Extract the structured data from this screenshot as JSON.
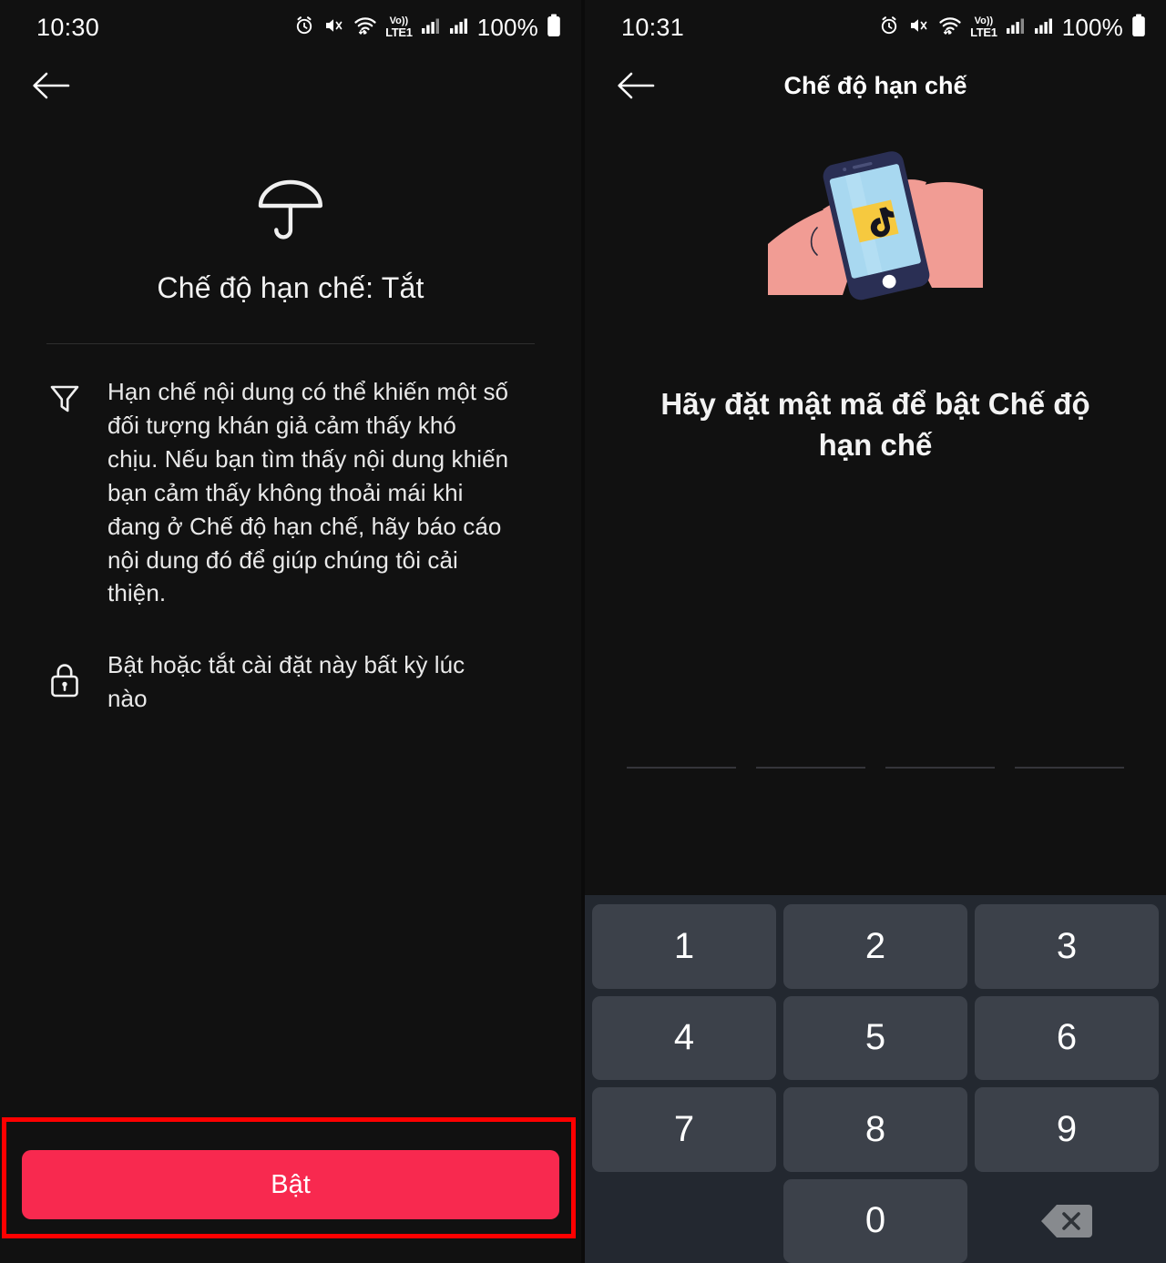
{
  "screens": [
    {
      "id": "restricted-mode-intro",
      "statusbar": {
        "time": "10:30",
        "battery_text": "100%",
        "volte_label": "Vo))",
        "lte_label": "LTE1",
        "icons": [
          "alarm-icon",
          "mute-icon",
          "wifi-icon",
          "volte-icon",
          "signal-sim1-icon",
          "signal-sim2-icon",
          "battery-icon"
        ]
      },
      "navbar": {
        "back": "back-arrow-icon",
        "title": ""
      },
      "content": {
        "hero_icon": "umbrella-icon",
        "state_title": "Chế độ hạn chế: Tắt",
        "rows": [
          {
            "icon": "filter-funnel-icon",
            "text": "Hạn chế nội dung có thể khiến một số đối tượng khán giả cảm thấy khó chịu. Nếu bạn tìm thấy nội dung khiến bạn cảm thấy không thoải mái khi đang ở Chế độ hạn chế, hãy báo cáo nội dung đó để giúp chúng tôi cải thiện."
          },
          {
            "icon": "lock-icon",
            "text": "Bật hoặc tắt cài đặt này bất kỳ lúc nào"
          }
        ]
      },
      "cta": {
        "label": "Bật",
        "color": "#f8294f",
        "highlight_color": "#fe0000"
      }
    },
    {
      "id": "set-passcode",
      "statusbar": {
        "time": "10:31",
        "battery_text": "100%",
        "volte_label": "Vo))",
        "lte_label": "LTE1",
        "icons": [
          "alarm-icon",
          "mute-icon",
          "wifi-icon",
          "volte-icon",
          "signal-sim1-icon",
          "signal-sim2-icon",
          "battery-icon"
        ]
      },
      "navbar": {
        "back": "back-arrow-icon",
        "title": "Chế độ hạn chế"
      },
      "content": {
        "illustration": "hands-holding-phone-tiktok-illustration",
        "heading": "Hãy đặt mật mã để bật Chế độ hạn chế",
        "pin_slots": 4,
        "pin_value": ""
      },
      "keypad": {
        "keys": [
          "1",
          "2",
          "3",
          "4",
          "5",
          "6",
          "7",
          "8",
          "9",
          "",
          "0",
          "backspace-icon"
        ],
        "background": "#232830",
        "key_color": "#3c414a"
      }
    }
  ]
}
